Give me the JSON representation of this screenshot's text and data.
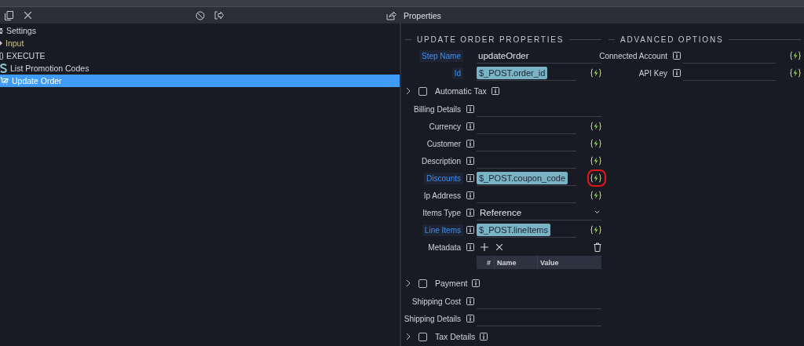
{
  "tree": {
    "items": [
      {
        "label": "Settings",
        "kind": "settings",
        "selected": false
      },
      {
        "label": "Input",
        "kind": "input",
        "selected": false
      },
      {
        "label": "EXECUTE",
        "kind": "execute",
        "selected": false
      },
      {
        "label": "List Promotion Codes",
        "kind": "stripe",
        "selected": false
      },
      {
        "label": "Update Order",
        "kind": "cart",
        "selected": true
      }
    ]
  },
  "properties": {
    "title": "Properties",
    "sections": [
      {
        "title": "UPDATE ORDER PROPERTIES",
        "rows": [
          {
            "kind": "field",
            "label": "Step Name",
            "highlighted": true,
            "info": false,
            "text": "updateOrder",
            "dynamic": false
          },
          {
            "kind": "field",
            "label": "Id",
            "highlighted": true,
            "info": false,
            "chip": "$_POST.order_id",
            "dynamic": true
          },
          {
            "kind": "group",
            "label": "Automatic Tax",
            "checked": false,
            "expanded": false
          },
          {
            "kind": "field",
            "label": "Billing Details",
            "highlighted": false,
            "info": true,
            "dynamic": false
          },
          {
            "kind": "field",
            "label": "Currency",
            "highlighted": false,
            "info": true,
            "dynamic": true
          },
          {
            "kind": "field",
            "label": "Customer",
            "highlighted": false,
            "info": true,
            "dynamic": true
          },
          {
            "kind": "field",
            "label": "Description",
            "highlighted": false,
            "info": true,
            "dynamic": true
          },
          {
            "kind": "field",
            "label": "Discounts",
            "highlighted": true,
            "info": true,
            "chip": "$_POST.coupon_code",
            "dynamic": true,
            "circled": true
          },
          {
            "kind": "field",
            "label": "Ip Address",
            "highlighted": false,
            "info": true,
            "dynamic": true
          },
          {
            "kind": "select",
            "label": "Items Type",
            "highlighted": false,
            "info": true,
            "text": "Reference"
          },
          {
            "kind": "field",
            "label": "Line Items",
            "highlighted": true,
            "info": true,
            "chip": "$_POST.lineItems",
            "dynamic": true
          },
          {
            "kind": "list",
            "label": "Metadata",
            "info": true,
            "columns": [
              "#",
              "Name",
              "Value"
            ]
          },
          {
            "kind": "group",
            "label": "Payment",
            "checked": false,
            "expanded": false
          },
          {
            "kind": "field",
            "label": "Shipping Cost",
            "highlighted": false,
            "info": true,
            "dynamic": false
          },
          {
            "kind": "field",
            "label": "Shipping Details",
            "highlighted": false,
            "info": true,
            "dynamic": false
          },
          {
            "kind": "group",
            "label": "Tax Details",
            "checked": false,
            "expanded": false
          }
        ]
      },
      {
        "title": "ADVANCED OPTIONS",
        "rows": [
          {
            "kind": "field",
            "label": "Connected Account",
            "highlighted": false,
            "info": true,
            "dynamic": true
          },
          {
            "kind": "field",
            "label": "API Key",
            "highlighted": false,
            "info": true,
            "dynamic": true
          }
        ]
      }
    ]
  }
}
